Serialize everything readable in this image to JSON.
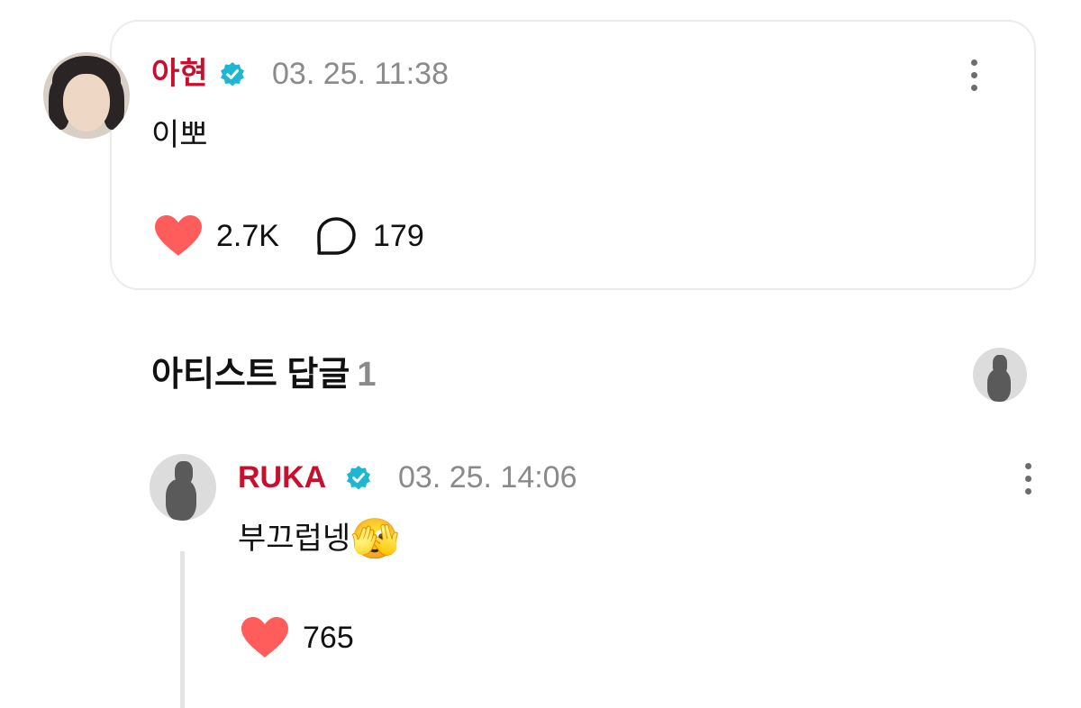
{
  "post": {
    "author": "아현",
    "time": "03. 25. 11:38",
    "text": "이뽀",
    "likes": "2.7K",
    "comments": "179"
  },
  "section": {
    "title": "아티스트 답글",
    "count": "1"
  },
  "reply": {
    "author": "RUKA",
    "time": "03. 25. 14:06",
    "text": "부끄럽넹",
    "emoji": "🫣",
    "likes": "765"
  },
  "colors": {
    "name": "#c8102e",
    "verified": "#1fb6cf",
    "heart": "#ff5c5c",
    "muted": "#8a8a8a"
  },
  "icons": [
    "verified-badge-icon",
    "heart-icon",
    "comment-bubble-icon",
    "more-options-icon"
  ]
}
